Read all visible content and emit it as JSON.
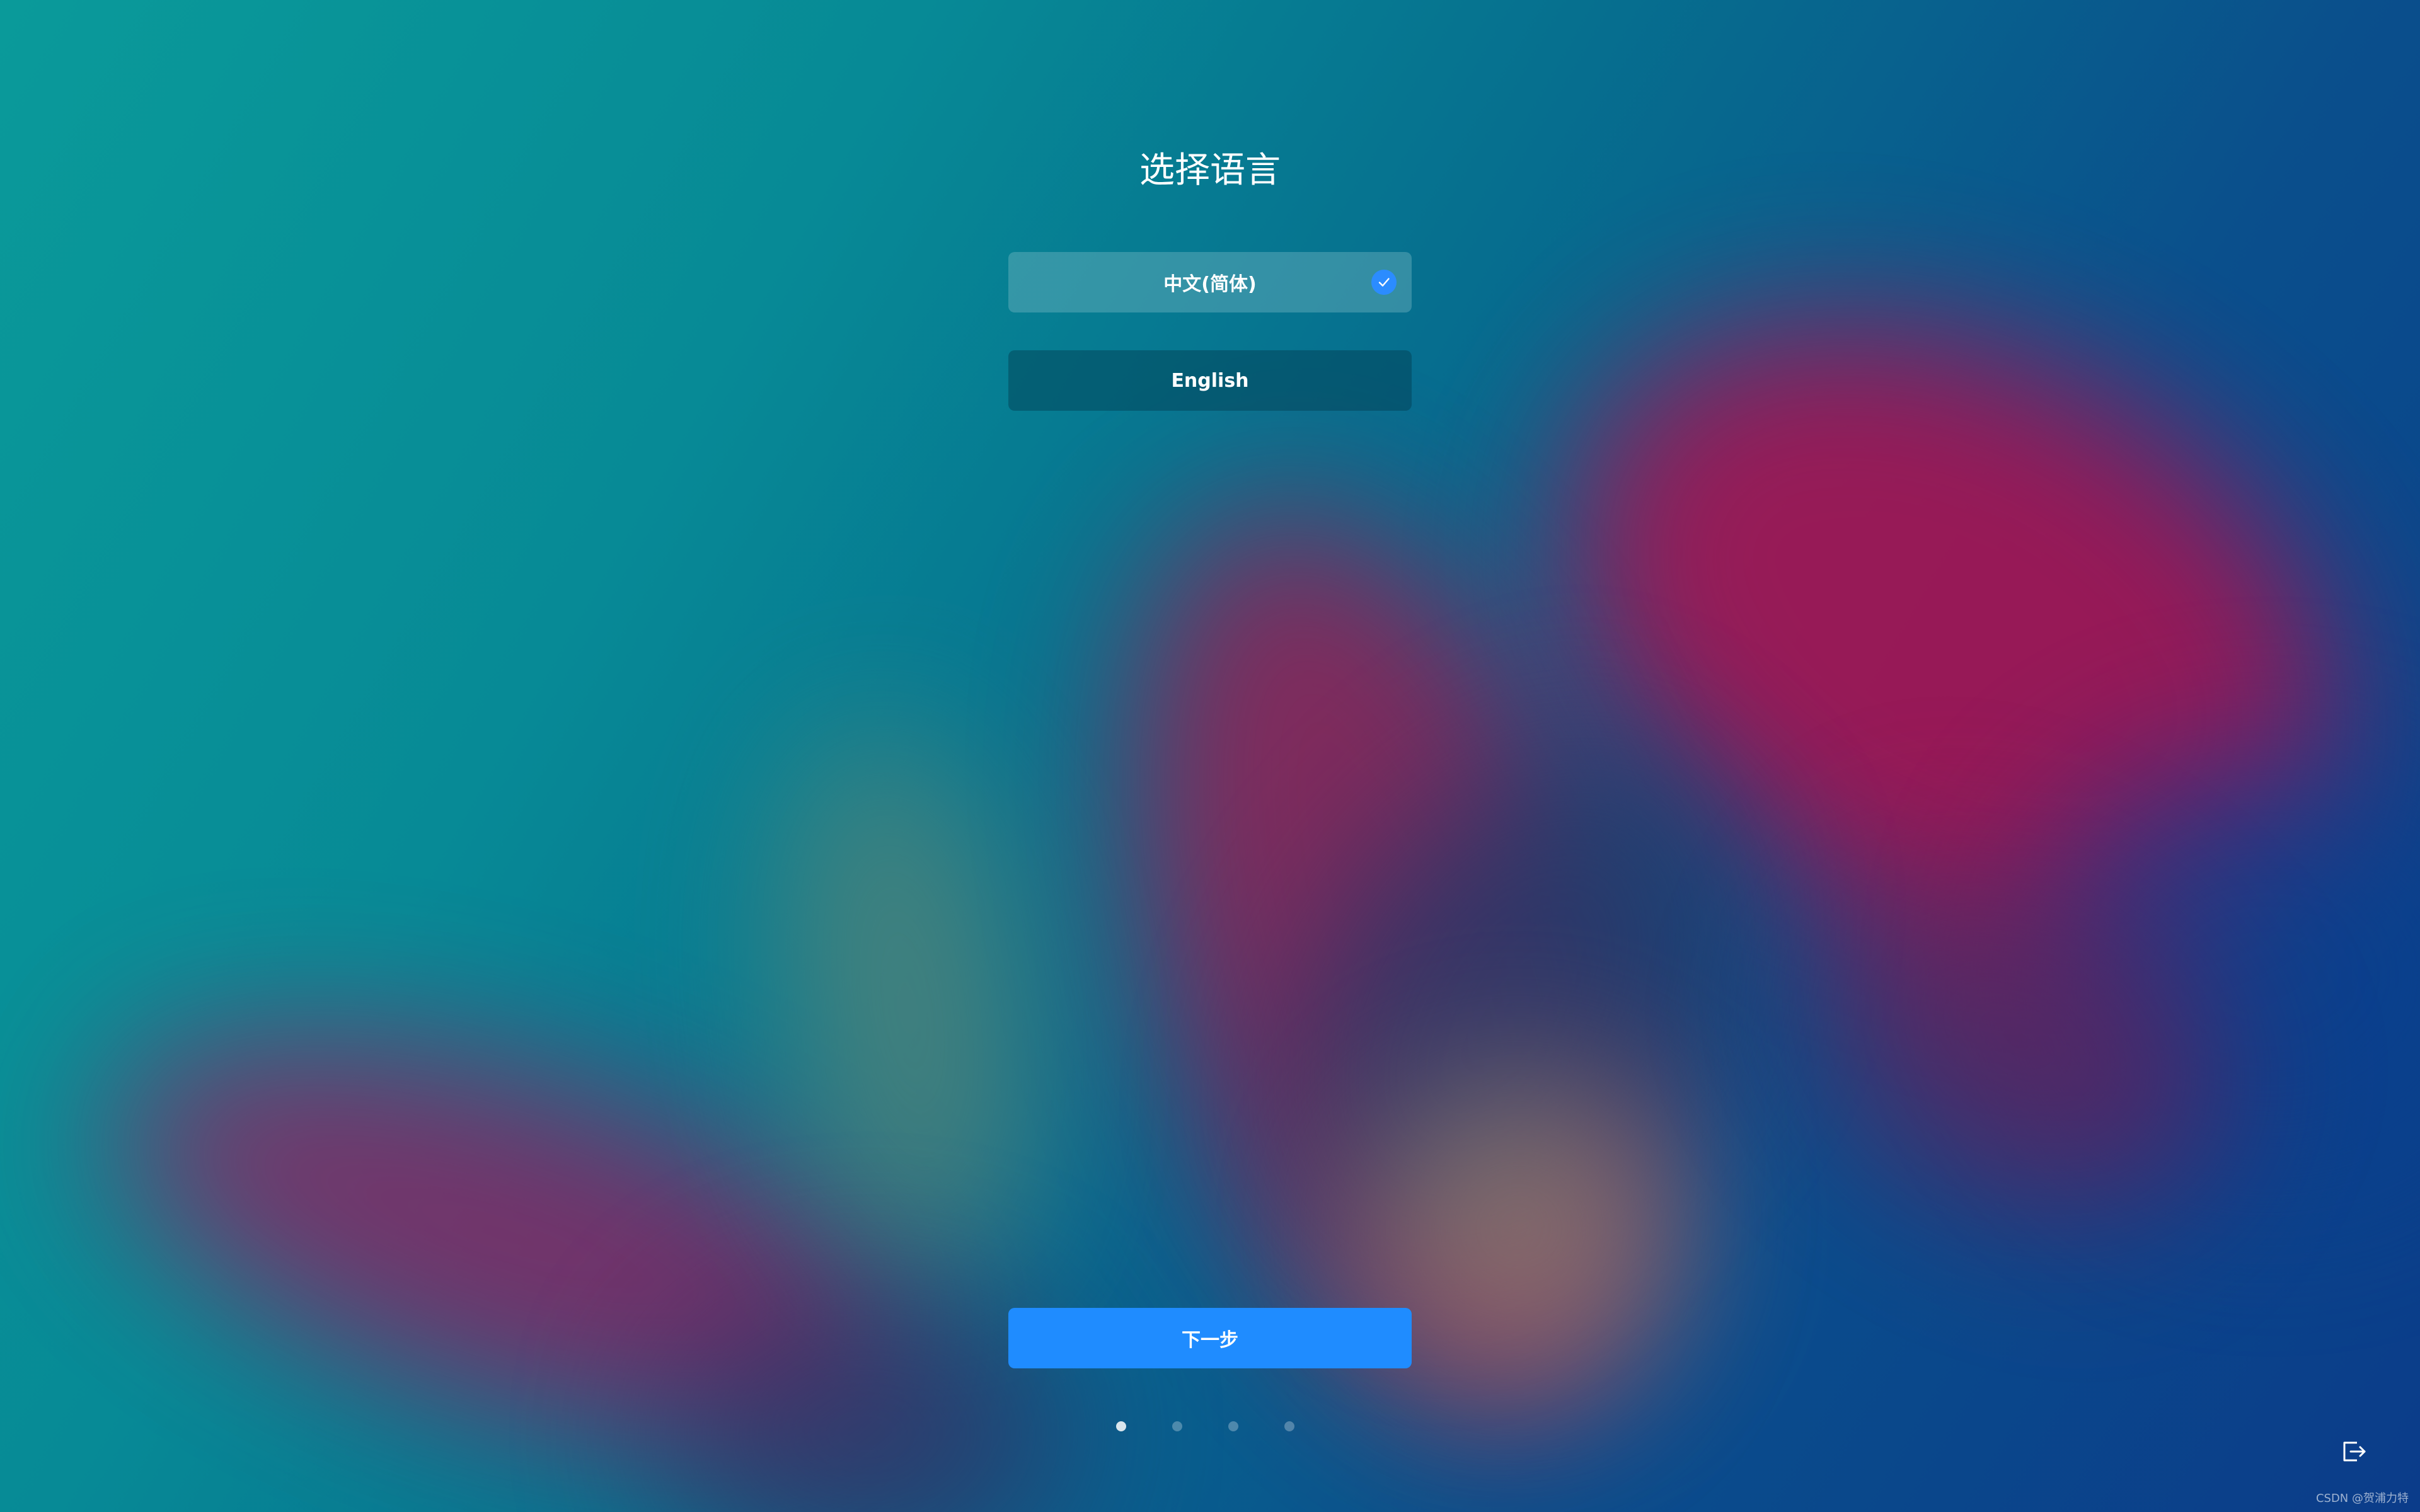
{
  "page": {
    "title": "选择语言"
  },
  "languages": [
    {
      "label": "中文(简体)",
      "selected": true
    },
    {
      "label": "English",
      "selected": false
    }
  ],
  "next_button": {
    "label": "下一步"
  },
  "pager": {
    "total": 4,
    "current": 1
  },
  "icons": {
    "check": "check-icon",
    "exit": "logout-icon"
  },
  "colors": {
    "accent": "#1f8cff",
    "check": "#2b8cff"
  },
  "watermark": "CSDN @贺浦力特"
}
